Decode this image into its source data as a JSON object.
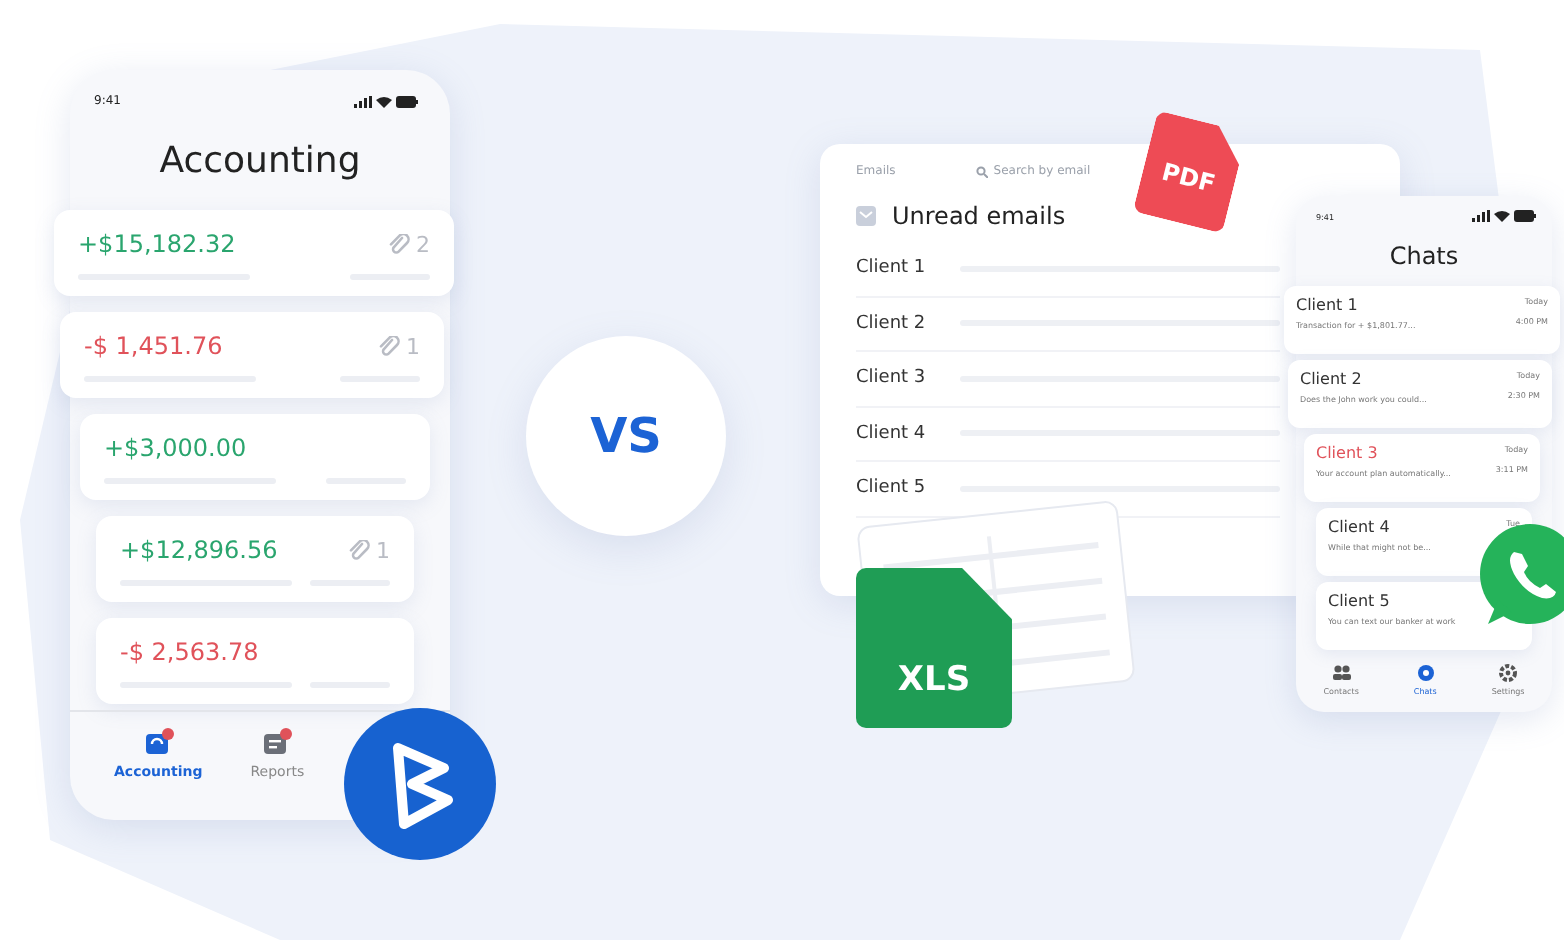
{
  "accounting_app": {
    "status_time": "9:41",
    "title": "Accounting",
    "transactions": [
      {
        "amount": "+$15,182.32",
        "kind": "income",
        "attachments": "2"
      },
      {
        "amount": "-$ 1,451.76",
        "kind": "expense",
        "attachments": "1"
      },
      {
        "amount": "+$3,000.00",
        "kind": "income"
      },
      {
        "amount": "+$12,896.56",
        "kind": "income",
        "attachments": "1"
      },
      {
        "amount": "-$ 2,563.78",
        "kind": "expense"
      }
    ],
    "nav": [
      {
        "label": "Accounting",
        "selected": true
      },
      {
        "label": "Reports",
        "selected": false
      }
    ]
  },
  "comparison_label": "VS",
  "email_app": {
    "title": "Emails",
    "search": {
      "placeholder": "Search by email"
    },
    "folder": "Unread emails",
    "rows": [
      "Client 1",
      "Client 2",
      "Client 3",
      "Client 4",
      "Client 5"
    ]
  },
  "file_badges": [
    {
      "kind": "pdf",
      "label": "PDF"
    },
    {
      "kind": "xls",
      "label": "XLS"
    }
  ],
  "chat_app": {
    "status_time": "9:41",
    "title": "Chats",
    "chats": [
      {
        "name": "Client 1",
        "preview": "Transaction for + $1,801.77...",
        "day": "Today",
        "time": "4:00 PM",
        "highlighted": false
      },
      {
        "name": "Client 2",
        "preview": "Does the John work you could...",
        "day": "Today",
        "time": "2:30 PM",
        "highlighted": false
      },
      {
        "name": "Client 3",
        "preview": "Your account plan automatically...",
        "day": "Today",
        "time": "3:11 PM",
        "highlighted": true
      },
      {
        "name": "Client 4",
        "preview": "While that might not be...",
        "day": "Tue",
        "highlighted": false
      },
      {
        "name": "Client 5",
        "preview": "You can text our banker at work",
        "highlighted": false
      }
    ],
    "nav": [
      {
        "label": "Contacts",
        "selected": false
      },
      {
        "label": "Chats",
        "selected": true
      },
      {
        "label": "Settings",
        "selected": false
      }
    ]
  }
}
